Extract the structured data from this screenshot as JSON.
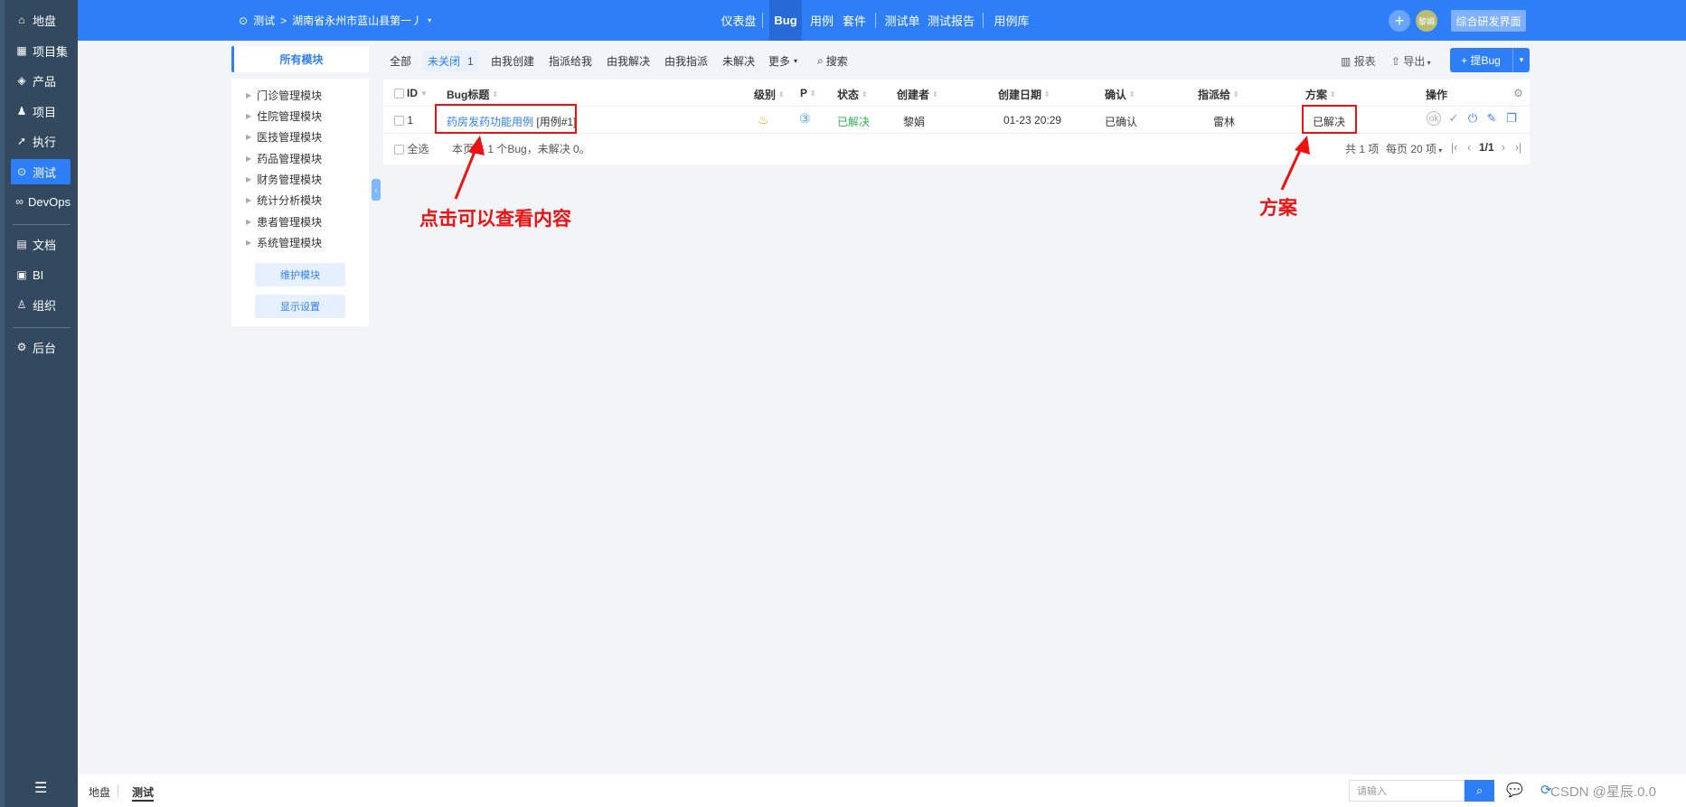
{
  "leftnav": {
    "items": [
      {
        "icon": "⌂",
        "label": "地盘"
      },
      {
        "icon": "▦",
        "label": "项目集"
      },
      {
        "icon": "◈",
        "label": "产品"
      },
      {
        "icon": "♟",
        "label": "项目"
      },
      {
        "icon": "➚",
        "label": "执行"
      },
      {
        "icon": "⊙",
        "label": "测试"
      },
      {
        "icon": "∞",
        "label": "DevOps"
      },
      {
        "icon": "▤",
        "label": "文档"
      },
      {
        "icon": "▣",
        "label": "BI"
      },
      {
        "icon": "♙",
        "label": "组织"
      },
      {
        "icon": "⚙",
        "label": "后台"
      }
    ],
    "menu_toggle": "☰"
  },
  "header": {
    "breadcrumb_root": "测试",
    "breadcrumb_sep": ">",
    "breadcrumb_product": "湖南省永州市蓝山县第一丿",
    "nav": [
      "仪表盘",
      "Bug",
      "用例",
      "套件",
      "测试单",
      "测试报告",
      "用例库"
    ],
    "plus": "+",
    "avatar": "黎娟",
    "switch_label": "综合研发界面"
  },
  "modules": {
    "tab": "所有模块",
    "items": [
      "门诊管理模块",
      "住院管理模块",
      "医技管理模块",
      "药品管理模块",
      "财务管理模块",
      "统计分析模块",
      "患者管理模块",
      "系统管理模块"
    ],
    "maintain_btn": "维护模块",
    "display_btn": "显示设置"
  },
  "toolbar": {
    "all": "全部",
    "unclosed": "未关闭",
    "unclosed_count": "1",
    "created_by_me": "由我创建",
    "assigned_to_me": "指派给我",
    "resolved_by_me": "由我解决",
    "assigned_by_me": "由我指派",
    "unresolved": "未解决",
    "more": "更多",
    "search": "搜索",
    "report": "报表",
    "export": "导出",
    "add_bug": "提Bug"
  },
  "table": {
    "columns": [
      "ID",
      "Bug标题",
      "级别",
      "P",
      "状态",
      "创建者",
      "创建日期",
      "确认",
      "指派给",
      "方案",
      "操作"
    ],
    "rows": [
      {
        "id": "1",
        "title": "药房发药功能用例",
        "case_ref": "[用例#1]",
        "severity": "♨",
        "priority": "③",
        "status": "已解决",
        "creator": "黎娟",
        "created": "01-23 20:29",
        "confirmed": "已确认",
        "assignee": "雷林",
        "resolution": "已解决"
      }
    ],
    "select_all": "全选",
    "summary": "本页共 1 个Bug，未解决 0。",
    "total": "共 1 项",
    "per_page": "每页 20 项",
    "page": "1/1"
  },
  "annotations": {
    "click_note": "点击可以查看内容",
    "resolution_note": "方案"
  },
  "bottombar": {
    "item1": "地盘",
    "item2": "测试",
    "search_placeholder": "请输入",
    "watermark": "CSDN @星辰.0.0"
  },
  "colors": {
    "accent": "#2e7ff7",
    "nav": "#33495f",
    "annotation": "#e11111",
    "success": "#2fb358"
  }
}
